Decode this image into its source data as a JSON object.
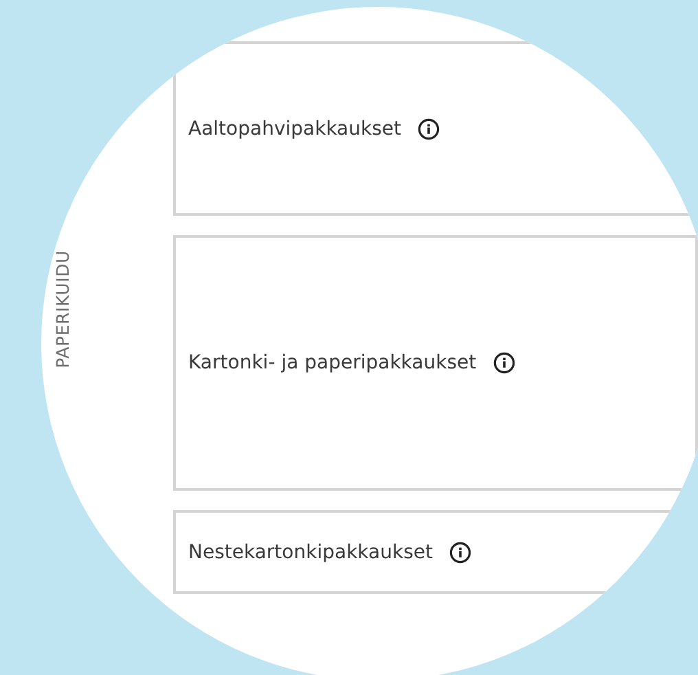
{
  "side_label": "PAPERIKUIDU",
  "cards": [
    {
      "label": "Aaltopahvipakkaukset"
    },
    {
      "label": "Kartonki- ja paperipakkaukset"
    },
    {
      "label": "Nestekartonkipakkaukset"
    }
  ]
}
